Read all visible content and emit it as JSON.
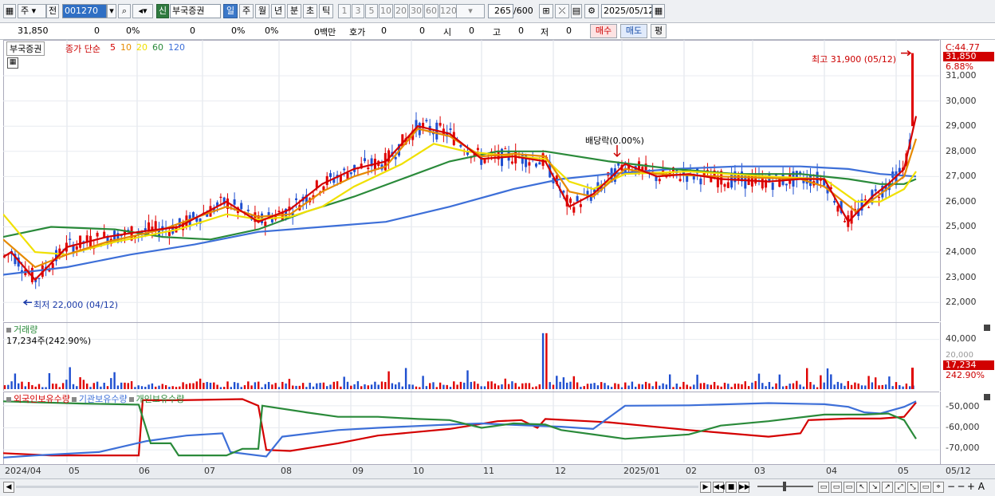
{
  "toolbar": {
    "type_select": "주",
    "prev_label": "전",
    "code": "001270",
    "badge": "신",
    "stock_name": "부국증권",
    "periods": [
      "일",
      "주",
      "월",
      "년",
      "분",
      "초",
      "틱"
    ],
    "intervals": [
      "1",
      "3",
      "5",
      "10",
      "20",
      "30",
      "60",
      "120"
    ],
    "count_value": "265",
    "count_total": "/600",
    "date": "2025/05/12"
  },
  "quote": {
    "price": "31,850",
    "change": "0",
    "change_pct": "0%",
    "volume": "0",
    "vol_pct1": "0%",
    "vol_pct2": "0%",
    "amount": "0백만",
    "hoga_label": "호가",
    "hoga_v1": "0",
    "hoga_v2": "0",
    "open_label": "시",
    "open_val": "0",
    "high_label": "고",
    "high_val": "0",
    "low_label": "저",
    "low_val": "0",
    "buy_label": "매수",
    "sell_label": "매도",
    "eval_label": "평"
  },
  "price_panel": {
    "stock_tag": "부국증권",
    "ma_label": "종가 단순",
    "ma_periods": [
      "5",
      "10",
      "20",
      "60",
      "120"
    ],
    "ma_colors": [
      "#d40000",
      "#e68a00",
      "#f0e000",
      "#2a8a3a",
      "#3d6fd8"
    ],
    "max_note": "최고 31,900 (05/12)",
    "min_note": "최저 22,000 (04/12)",
    "dividend_note": "배당락(0.00%)",
    "axis_top": "C:44.77",
    "current_price_tag": "31,850",
    "current_pct": "6.88%",
    "price_ticks": [
      "31,000",
      "30,000",
      "29,000",
      "28,000",
      "27,000",
      "26,000",
      "25,000",
      "24,000",
      "23,000",
      "22,000"
    ]
  },
  "volume_panel": {
    "title": "거래량",
    "value_text": "17,234주(242.90%)",
    "ticks": [
      "40,000",
      "20,000"
    ],
    "current_tag": "17,234",
    "current_pct": "242.90%"
  },
  "holding_panel": {
    "legend": [
      {
        "label": "외국인보유수량",
        "color": "#d40000"
      },
      {
        "label": "기관보유수량",
        "color": "#3d6fd8"
      },
      {
        "label": "개인보유수량",
        "color": "#2a8a3a"
      }
    ],
    "ticks": [
      "-50,000",
      "-60,000",
      "-70,000"
    ]
  },
  "x_axis": [
    "2024/04",
    "05",
    "06",
    "07",
    "08",
    "09",
    "10",
    "11",
    "12",
    "2025/01",
    "02",
    "03",
    "04",
    "05",
    "05/12"
  ],
  "chart_data": {
    "type": "line",
    "title": "",
    "xlabel": "",
    "ylabel": "",
    "ylim": [
      21500,
      32300
    ],
    "series": [
      {
        "name": "종가 단순 5",
        "points": [
          [
            0,
            23800
          ],
          [
            10,
            24000
          ],
          [
            40,
            22900
          ],
          [
            80,
            24200
          ],
          [
            130,
            24600
          ],
          [
            170,
            24800
          ],
          [
            220,
            25000
          ],
          [
            280,
            26000
          ],
          [
            320,
            25200
          ],
          [
            360,
            25700
          ],
          [
            400,
            26700
          ],
          [
            440,
            27300
          ],
          [
            480,
            27600
          ],
          [
            520,
            29000
          ],
          [
            560,
            28700
          ],
          [
            600,
            27700
          ],
          [
            640,
            27800
          ],
          [
            680,
            27600
          ],
          [
            710,
            25800
          ],
          [
            740,
            26300
          ],
          [
            780,
            27500
          ],
          [
            820,
            27000
          ],
          [
            860,
            27100
          ],
          [
            900,
            26900
          ],
          [
            960,
            26800
          ],
          [
            1000,
            26900
          ],
          [
            1030,
            26900
          ],
          [
            1060,
            25200
          ],
          [
            1090,
            26200
          ],
          [
            1110,
            26700
          ],
          [
            1130,
            27300
          ],
          [
            1145,
            29400
          ]
        ]
      },
      {
        "name": "종가 단순 10",
        "points": [
          [
            0,
            24500
          ],
          [
            40,
            23400
          ],
          [
            80,
            23900
          ],
          [
            130,
            24400
          ],
          [
            200,
            24900
          ],
          [
            280,
            25800
          ],
          [
            320,
            25400
          ],
          [
            360,
            25500
          ],
          [
            400,
            26400
          ],
          [
            440,
            27000
          ],
          [
            480,
            27400
          ],
          [
            520,
            28900
          ],
          [
            560,
            28600
          ],
          [
            600,
            27800
          ],
          [
            640,
            27900
          ],
          [
            680,
            27800
          ],
          [
            710,
            26400
          ],
          [
            740,
            26200
          ],
          [
            780,
            27300
          ],
          [
            820,
            27100
          ],
          [
            900,
            27000
          ],
          [
            1000,
            26900
          ],
          [
            1030,
            26600
          ],
          [
            1070,
            25600
          ],
          [
            1100,
            26300
          ],
          [
            1130,
            27000
          ],
          [
            1145,
            28500
          ]
        ]
      },
      {
        "name": "종가 단순 20",
        "points": [
          [
            0,
            25500
          ],
          [
            40,
            24000
          ],
          [
            80,
            23900
          ],
          [
            140,
            24400
          ],
          [
            220,
            24900
          ],
          [
            280,
            25500
          ],
          [
            320,
            25300
          ],
          [
            360,
            25400
          ],
          [
            400,
            25800
          ],
          [
            440,
            26600
          ],
          [
            500,
            27500
          ],
          [
            540,
            28300
          ],
          [
            580,
            28000
          ],
          [
            640,
            27800
          ],
          [
            680,
            27700
          ],
          [
            710,
            26800
          ],
          [
            740,
            26500
          ],
          [
            780,
            27100
          ],
          [
            860,
            27200
          ],
          [
            960,
            27000
          ],
          [
            1030,
            26900
          ],
          [
            1070,
            26000
          ],
          [
            1100,
            26000
          ],
          [
            1130,
            26500
          ],
          [
            1145,
            27200
          ]
        ]
      },
      {
        "name": "종가 단순 60",
        "points": [
          [
            0,
            24600
          ],
          [
            60,
            25000
          ],
          [
            140,
            24900
          ],
          [
            200,
            24600
          ],
          [
            260,
            24500
          ],
          [
            320,
            24900
          ],
          [
            380,
            25600
          ],
          [
            440,
            26200
          ],
          [
            500,
            26900
          ],
          [
            560,
            27600
          ],
          [
            620,
            28000
          ],
          [
            680,
            28000
          ],
          [
            760,
            27600
          ],
          [
            840,
            27300
          ],
          [
            920,
            27100
          ],
          [
            1000,
            27100
          ],
          [
            1060,
            26900
          ],
          [
            1100,
            26700
          ],
          [
            1130,
            26700
          ],
          [
            1145,
            26900
          ]
        ]
      },
      {
        "name": "종가 단순 120",
        "points": [
          [
            0,
            23100
          ],
          [
            80,
            23400
          ],
          [
            160,
            23900
          ],
          [
            240,
            24300
          ],
          [
            320,
            24800
          ],
          [
            400,
            25000
          ],
          [
            480,
            25200
          ],
          [
            560,
            25800
          ],
          [
            640,
            26500
          ],
          [
            700,
            26900
          ],
          [
            760,
            27100
          ],
          [
            840,
            27300
          ],
          [
            920,
            27400
          ],
          [
            1000,
            27400
          ],
          [
            1060,
            27300
          ],
          [
            1100,
            27100
          ],
          [
            1145,
            27000
          ]
        ]
      }
    ],
    "holding_series": [
      {
        "name": "외국인보유수량",
        "points": [
          [
            0,
            -71500
          ],
          [
            60,
            -72500
          ],
          [
            170,
            -72500
          ],
          [
            175,
            -47500
          ],
          [
            220,
            -47500
          ],
          [
            300,
            -47000
          ],
          [
            320,
            -50000
          ],
          [
            330,
            -70000
          ],
          [
            360,
            -70500
          ],
          [
            420,
            -67000
          ],
          [
            470,
            -63500
          ],
          [
            560,
            -60500
          ],
          [
            620,
            -57000
          ],
          [
            650,
            -56500
          ],
          [
            670,
            -60000
          ],
          [
            680,
            -56000
          ],
          [
            760,
            -57500
          ],
          [
            860,
            -61000
          ],
          [
            960,
            -64000
          ],
          [
            1000,
            -62500
          ],
          [
            1010,
            -56500
          ],
          [
            1060,
            -55800
          ],
          [
            1100,
            -55800
          ],
          [
            1130,
            -55000
          ],
          [
            1145,
            -48500
          ]
        ]
      },
      {
        "name": "기관보유수량",
        "points": [
          [
            0,
            -73500
          ],
          [
            40,
            -72500
          ],
          [
            120,
            -71000
          ],
          [
            180,
            -66000
          ],
          [
            230,
            -63500
          ],
          [
            275,
            -62500
          ],
          [
            285,
            -71000
          ],
          [
            330,
            -73000
          ],
          [
            350,
            -64000
          ],
          [
            420,
            -61000
          ],
          [
            470,
            -60000
          ],
          [
            560,
            -58500
          ],
          [
            600,
            -58000
          ],
          [
            660,
            -59000
          ],
          [
            700,
            -59500
          ],
          [
            740,
            -60500
          ],
          [
            780,
            -50000
          ],
          [
            860,
            -49800
          ],
          [
            960,
            -48800
          ],
          [
            1030,
            -49300
          ],
          [
            1060,
            -50500
          ],
          [
            1080,
            -53000
          ],
          [
            1100,
            -53500
          ],
          [
            1130,
            -50500
          ],
          [
            1145,
            -48000
          ]
        ]
      },
      {
        "name": "개인보유수량",
        "points": [
          [
            0,
            -48000
          ],
          [
            100,
            -49000
          ],
          [
            170,
            -49500
          ],
          [
            185,
            -67000
          ],
          [
            210,
            -67000
          ],
          [
            220,
            -72500
          ],
          [
            280,
            -72500
          ],
          [
            300,
            -69500
          ],
          [
            320,
            -69500
          ],
          [
            325,
            -50000
          ],
          [
            380,
            -53000
          ],
          [
            420,
            -55000
          ],
          [
            470,
            -55000
          ],
          [
            520,
            -56000
          ],
          [
            560,
            -56500
          ],
          [
            600,
            -60000
          ],
          [
            640,
            -58000
          ],
          [
            680,
            -58500
          ],
          [
            700,
            -61000
          ],
          [
            780,
            -65000
          ],
          [
            860,
            -63000
          ],
          [
            900,
            -59000
          ],
          [
            960,
            -57000
          ],
          [
            1030,
            -54000
          ],
          [
            1080,
            -54000
          ],
          [
            1110,
            -53500
          ],
          [
            1130,
            -56500
          ],
          [
            1145,
            -65000
          ]
        ]
      }
    ],
    "holding_ylim": [
      -75000,
      -45000
    ],
    "volume_ylim": [
      0,
      50000
    ],
    "volume_last": 17234
  }
}
